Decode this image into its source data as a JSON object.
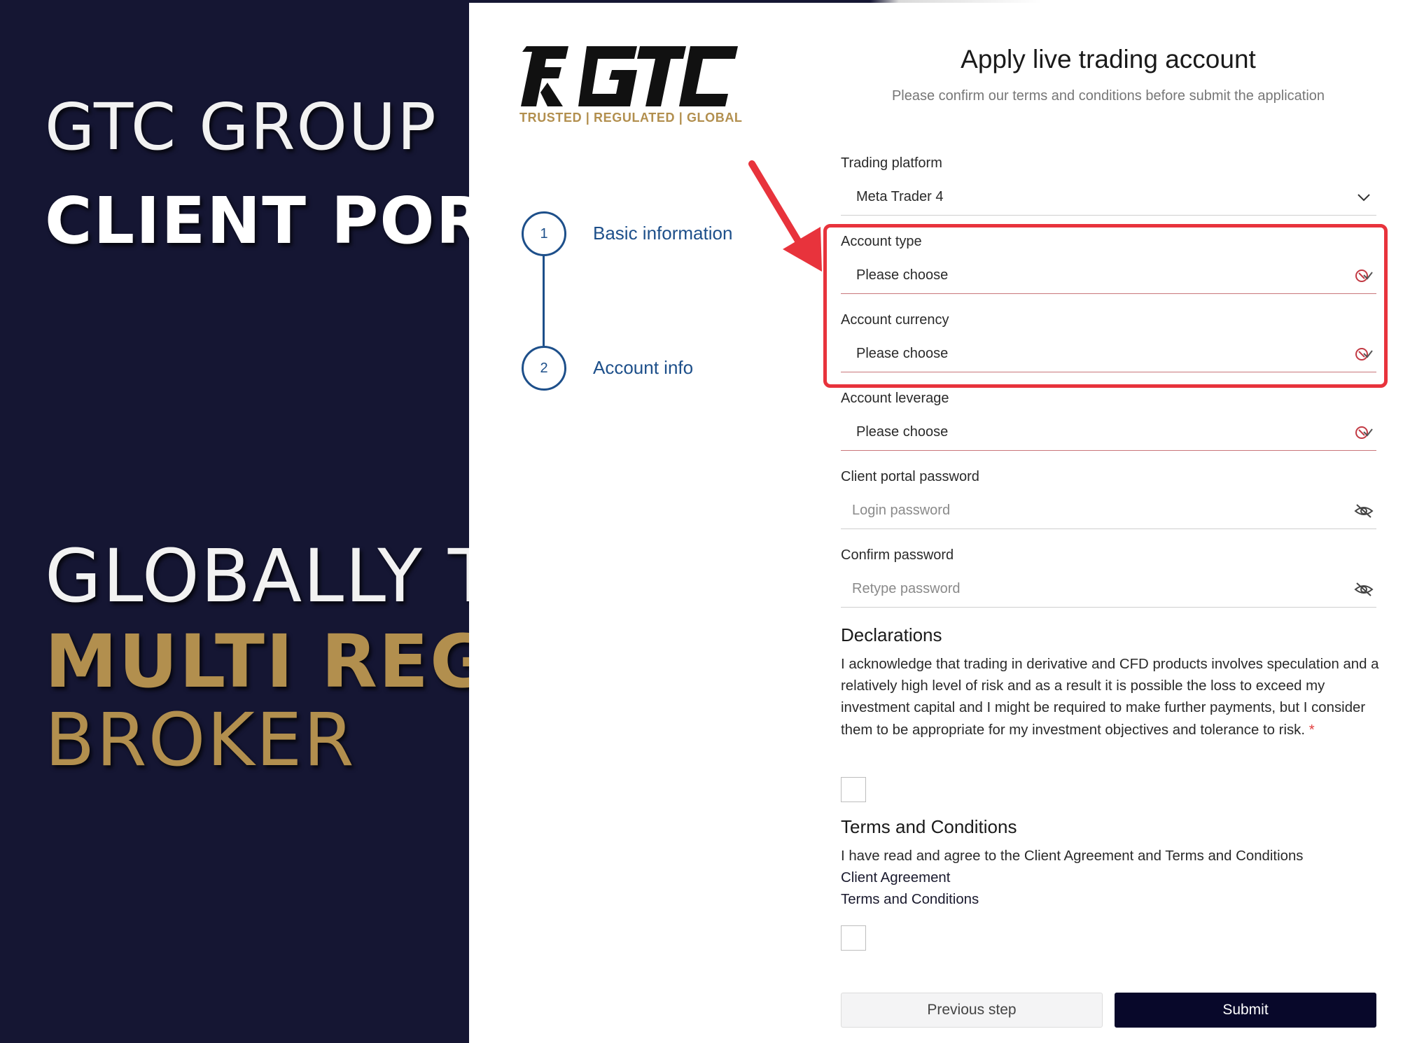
{
  "hero": {
    "line1": "GTC GROUP",
    "line2": "CLIENT PORTA",
    "line3": "GLOBALLY TF",
    "line4": "MULTI REGU",
    "line5": "BROKER"
  },
  "logo": {
    "tagline": "TRUSTED | REGULATED | GLOBAL",
    "icon": "gtc-logo"
  },
  "steps": [
    {
      "number": "1",
      "label": "Basic information"
    },
    {
      "number": "2",
      "label": "Account info"
    }
  ],
  "header": {
    "title": "Apply live trading account",
    "subtitle": "Please confirm our terms and conditions before submit the application"
  },
  "form": {
    "trading_platform": {
      "label": "Trading platform",
      "value": "Meta Trader 4",
      "icon": "chevron-down-icon"
    },
    "account_type": {
      "label": "Account type",
      "value": "Please choose",
      "icon": "clear-chevron-icon"
    },
    "account_currency": {
      "label": "Account currency",
      "value": "Please choose",
      "icon": "clear-chevron-icon"
    },
    "account_leverage": {
      "label": "Account leverage",
      "value": "Please choose",
      "icon": "clear-chevron-icon"
    },
    "portal_password": {
      "label": "Client portal password",
      "placeholder": "Login password",
      "icon": "eye-off-icon"
    },
    "confirm_password": {
      "label": "Confirm password",
      "placeholder": "Retype password",
      "icon": "eye-off-icon"
    }
  },
  "declarations": {
    "title": "Declarations",
    "text": "I acknowledge that trading in derivative and CFD products involves speculation and a relatively high level of risk and as a result it is possible the loss to exceed my investment capital and I might be required to make further payments, but I consider them to be appropriate for my investment objectives and tolerance to risk.",
    "required_mark": "*",
    "checked": false
  },
  "terms": {
    "title": "Terms and Conditions",
    "text": "I have read and agree to the Client Agreement and Terms and Conditions",
    "link_client_agreement": "Client Agreement",
    "link_terms": "Terms and Conditions",
    "checked": false
  },
  "buttons": {
    "previous": "Previous step",
    "submit": "Submit"
  },
  "colors": {
    "hero_bg": "#151633",
    "gold": "#b28f4e",
    "step_blue": "#1d4f8a",
    "highlight_red": "#e8333c",
    "submit_bg": "#08082a"
  }
}
